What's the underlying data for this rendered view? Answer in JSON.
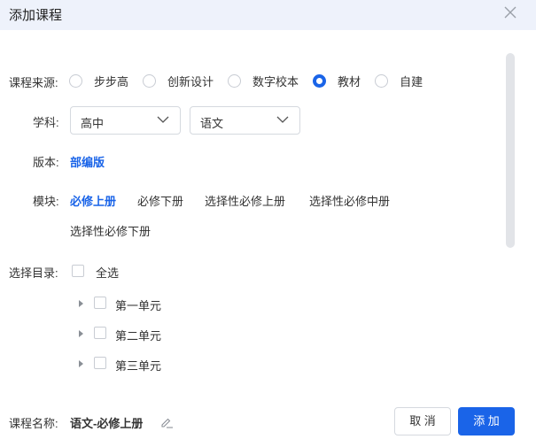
{
  "dialog": {
    "title": "添加课程",
    "close_icon": "close-icon"
  },
  "source": {
    "label": "课程来源:",
    "options": [
      {
        "label": "步步高",
        "checked": false
      },
      {
        "label": "创新设计",
        "checked": false
      },
      {
        "label": "数字校本",
        "checked": false
      },
      {
        "label": "教材",
        "checked": true
      },
      {
        "label": "自建",
        "checked": false
      }
    ]
  },
  "subject": {
    "label": "学科:",
    "stage_value": "高中",
    "subject_value": "语文"
  },
  "edition": {
    "label": "版本:",
    "value": "部编版"
  },
  "module": {
    "label": "模块:",
    "items": [
      "必修上册",
      "必修下册",
      "选择性必修上册",
      "选择性必修中册",
      "选择性必修下册"
    ],
    "active_index": 0
  },
  "catalog": {
    "label": "选择目录:",
    "select_all": "全选",
    "units": [
      "第一单元",
      "第二单元",
      "第三单元"
    ]
  },
  "course_name": {
    "label": "课程名称:",
    "value": "语文-必修上册",
    "edit_icon": "edit-icon"
  },
  "footer": {
    "cancel_label": "取 消",
    "add_label": "添 加"
  },
  "colors": {
    "accent": "#1a64e8",
    "header_bg": "#eef2fb"
  }
}
